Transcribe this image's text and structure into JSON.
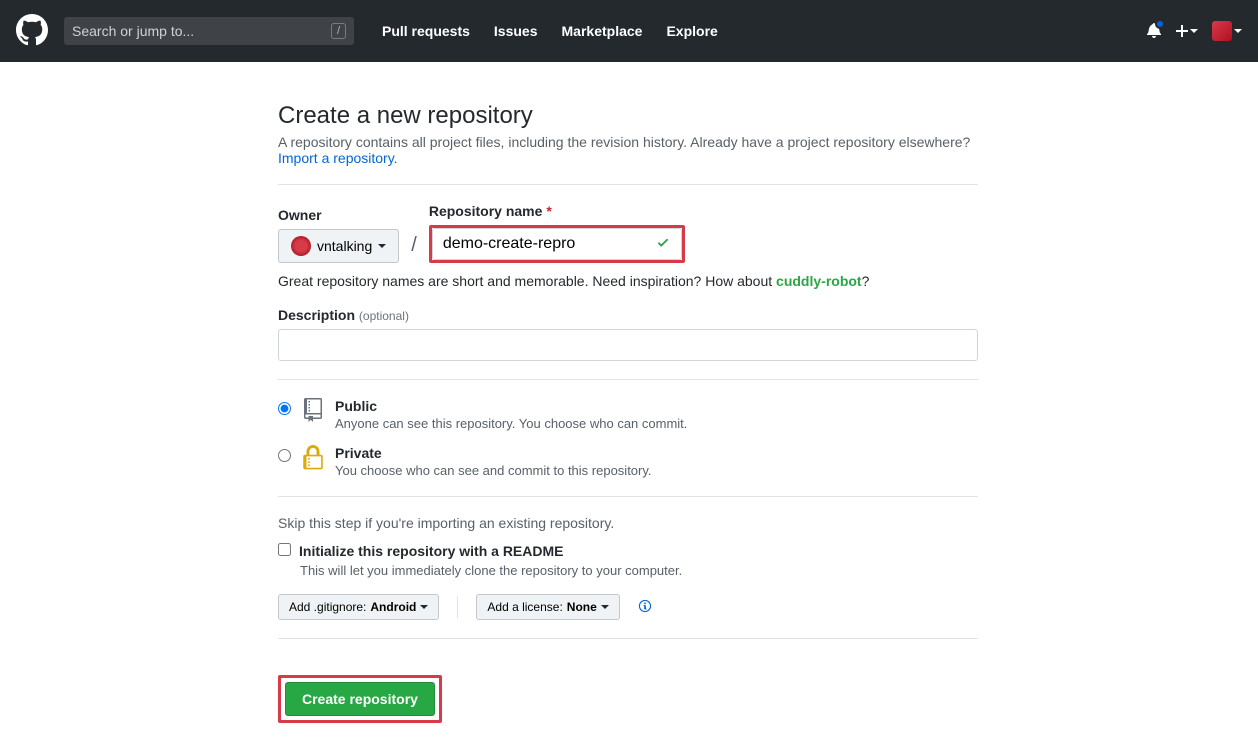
{
  "header": {
    "search_placeholder": "Search or jump to...",
    "nav": {
      "pull_requests": "Pull requests",
      "issues": "Issues",
      "marketplace": "Marketplace",
      "explore": "Explore"
    }
  },
  "page": {
    "title": "Create a new repository",
    "subtitle_a": "A repository contains all project files, including the revision history. Already have a project repository elsewhere?",
    "import_link": "Import a repository.",
    "owner_label": "Owner",
    "owner_value": "vntalking",
    "repo_label": "Repository name",
    "repo_value": "demo-create-repro",
    "hint_a": "Great repository names are short and memorable. Need inspiration? How about ",
    "hint_suggest": "cuddly-robot",
    "hint_q": "?",
    "desc_label": "Description",
    "optional": "(optional)",
    "public": {
      "title": "Public",
      "desc": "Anyone can see this repository. You choose who can commit."
    },
    "private": {
      "title": "Private",
      "desc": "You choose who can see and commit to this repository."
    },
    "skip_note": "Skip this step if you're importing an existing repository.",
    "readme_label": "Initialize this repository with a README",
    "readme_hint": "This will let you immediately clone the repository to your computer.",
    "gitignore_prefix": "Add .gitignore: ",
    "gitignore_value": "Android",
    "license_prefix": "Add a license: ",
    "license_value": "None",
    "create_btn": "Create repository"
  }
}
